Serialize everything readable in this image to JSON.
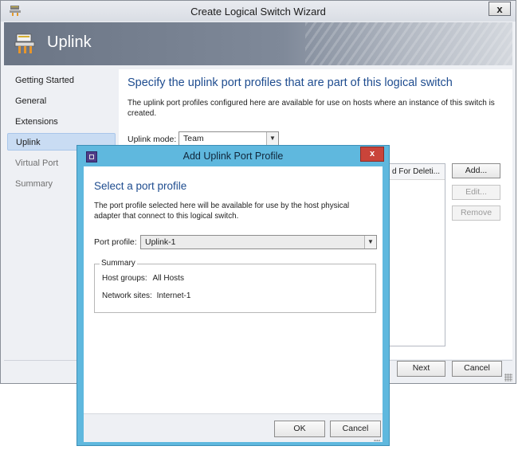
{
  "wizard": {
    "title": "Create Logical Switch Wizard",
    "close_glyph": "x",
    "banner_title": "Uplink",
    "nav": [
      {
        "label": "Getting Started",
        "state": "normal"
      },
      {
        "label": "General",
        "state": "normal"
      },
      {
        "label": "Extensions",
        "state": "normal"
      },
      {
        "label": "Uplink",
        "state": "selected"
      },
      {
        "label": "Virtual Port",
        "state": "disabled"
      },
      {
        "label": "Summary",
        "state": "disabled"
      }
    ],
    "heading": "Specify the uplink port profiles that are part of this logical switch",
    "description": "The uplink port profiles configured here are available for use on hosts where an instance of this switch is created.",
    "uplink_mode_label": "Uplink mode:",
    "uplink_mode_value": "Team",
    "column_header": "d For Deleti...",
    "add_label": "Add...",
    "edit_label": "Edit...",
    "remove_label": "Remove",
    "next_label": "Next",
    "cancel_label": "Cancel"
  },
  "dialog": {
    "title": "Add Uplink Port Profile",
    "close_glyph": "x",
    "heading": "Select a port profile",
    "description": "The port profile selected here will be available for use by the host physical adapter that connect to this logical switch.",
    "port_profile_label": "Port profile:",
    "port_profile_value": "Uplink-1",
    "summary_legend": "Summary",
    "host_groups_label": "Host groups:",
    "host_groups_value": "All Hosts",
    "network_sites_label": "Network sites:",
    "network_sites_value": "Internet-1",
    "ok_label": "OK",
    "cancel_label": "Cancel"
  },
  "colors": {
    "accent_heading": "#1e4c8f",
    "dialog_frame": "#5fb8de",
    "dialog_close": "#c9443a",
    "nav_selected": "#c9dcf3"
  },
  "icons": {
    "app": "server-switch-icon",
    "banner": "uplink-server-icon",
    "dialog": "dialog-app-icon"
  }
}
